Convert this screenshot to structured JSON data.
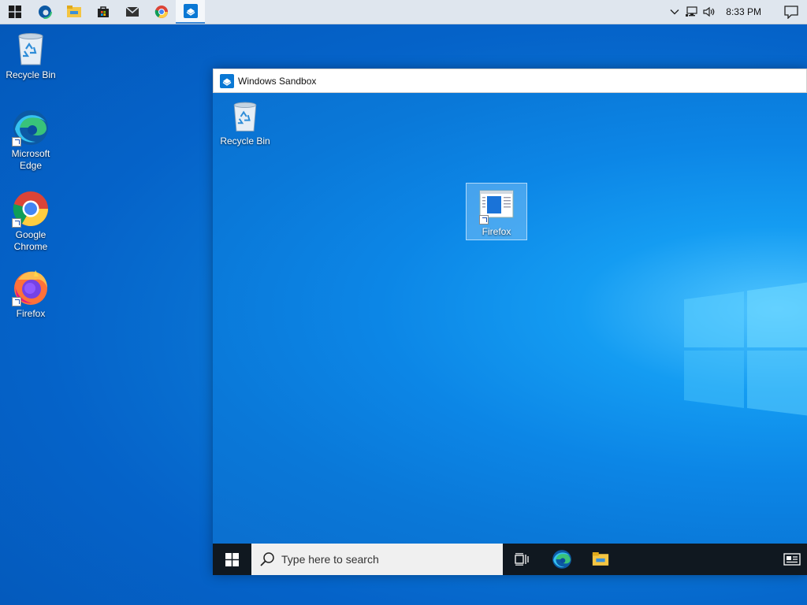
{
  "host_taskbar": {
    "icons": [
      "windows-start-icon",
      "edge-icon",
      "file-explorer-icon",
      "store-icon",
      "mail-icon",
      "chrome-icon",
      "windows-sandbox-icon"
    ],
    "tray": {
      "icons": [
        "chevron-up-icon",
        "network-icon",
        "volume-icon"
      ],
      "time": "8:33 PM",
      "notification_icon": "action-center-icon"
    }
  },
  "host_desktop": {
    "icons": [
      {
        "label": "Recycle Bin",
        "icon": "recycle-bin-icon"
      },
      {
        "label": "Microsoft Edge",
        "icon": "edge-icon"
      },
      {
        "label": "Google Chrome",
        "icon": "chrome-icon"
      },
      {
        "label": "Firefox",
        "icon": "firefox-icon"
      }
    ]
  },
  "sandbox_window": {
    "title": "Windows Sandbox",
    "desktop_icons": [
      {
        "label": "Recycle Bin",
        "icon": "recycle-bin-icon"
      },
      {
        "label": "Firefox",
        "icon": "application-icon"
      }
    ],
    "taskbar": {
      "search_placeholder": "Type here to search",
      "icons": [
        "windows-start-icon",
        "search-icon",
        "task-view-icon",
        "edge-icon",
        "file-explorer-icon",
        "news-icon"
      ]
    }
  },
  "colors": {
    "host_taskbar": "#dfe6ee",
    "sandbox_taskbar": "#101820",
    "accent": "#0078d7"
  }
}
